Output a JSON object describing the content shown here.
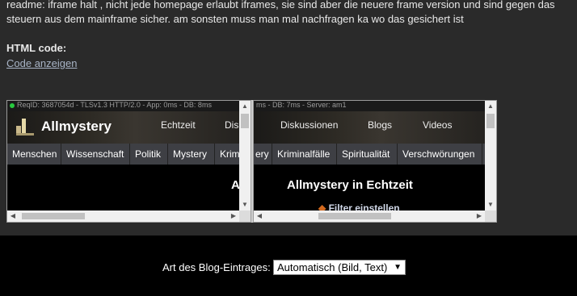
{
  "readme": {
    "line1": "readme: iframe halt , nicht jede homepage erlaubt iframes, sie sind aber die neuere frame version und sind gegen das",
    "line2": "steuern aus dem mainframe sicher. am sonsten muss man mal nachfragen ka wo das gesichert ist"
  },
  "html_code": {
    "label": "HTML code:",
    "link": "Code anzeigen"
  },
  "frame1": {
    "req": "ReqID: 3687054d - TLSv1.3 HTTP/2.0 - App: 0ms - DB: 8ms",
    "logo": "Allmystery",
    "nav": [
      "Echtzeit",
      "Dis"
    ],
    "cats": [
      "Menschen",
      "Wissenschaft",
      "Politik",
      "Mystery",
      "Krim"
    ],
    "title": "A"
  },
  "frame2": {
    "req": "ms - DB: 7ms - Server: am1",
    "nav": [
      "Diskussionen",
      "Blogs",
      "Videos"
    ],
    "cats": [
      "ery",
      "Kriminalfälle",
      "Spiritualität",
      "Verschwörungen"
    ],
    "title": "Allmystery in Echtzeit",
    "filter": "Filter einstellen"
  },
  "blog": {
    "label": "Art des Blog-Eintrages:",
    "selected": "Automatisch (Bild, Text)"
  },
  "icons": {
    "status": "green-dot-icon",
    "logo": "allmystery-logo-icon",
    "scroll_up": "arrow-up-icon",
    "scroll_down": "arrow-down-icon",
    "scroll_left": "arrow-left-icon",
    "scroll_right": "arrow-right-icon",
    "dropdown": "chevron-down-icon"
  },
  "colors": {
    "status_green": "#27c93f",
    "link": "#a8b4c6",
    "category_bar": "#3e3f44"
  }
}
